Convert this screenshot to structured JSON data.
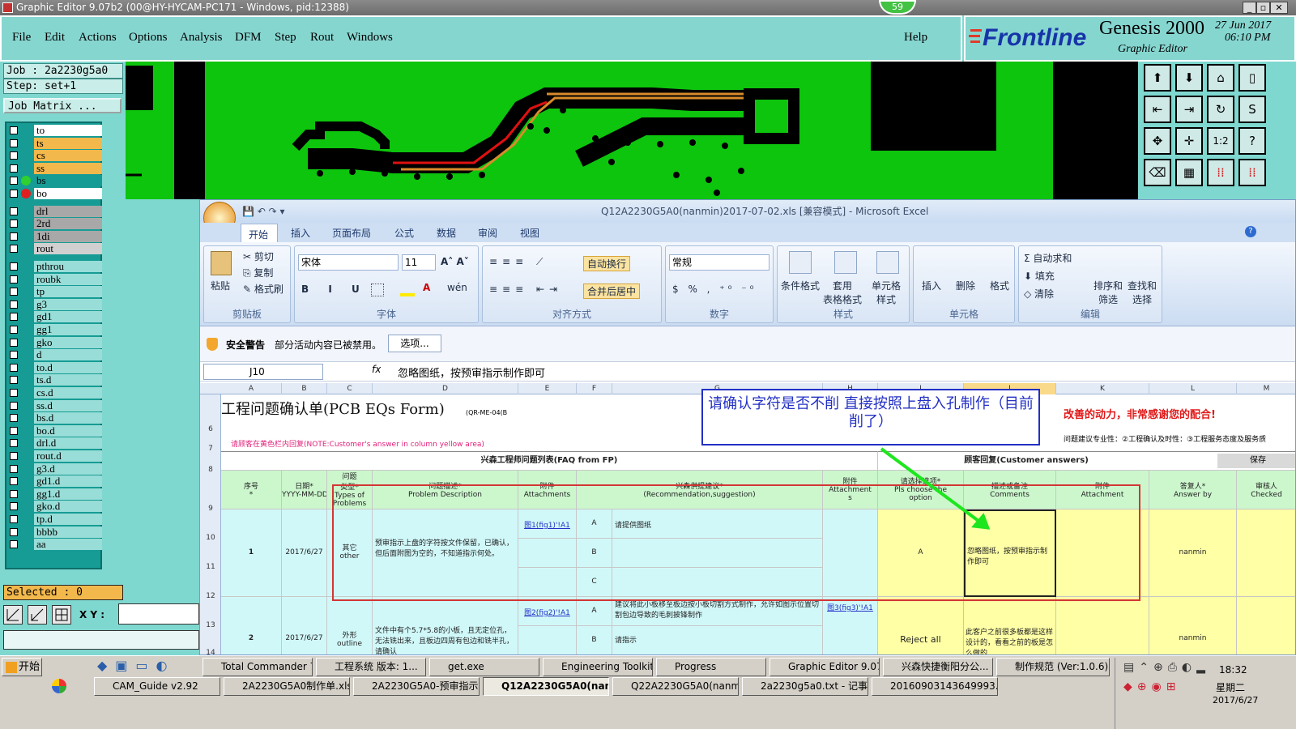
{
  "window": {
    "title": "Graphic Editor 9.07b2 (00@HY-HYCAM-PC171 - Windows, pid:12388)",
    "badge": "59"
  },
  "menu": [
    "File",
    "Edit",
    "Actions",
    "Options",
    "Analysis",
    "DFM",
    "Step",
    "Rout",
    "Windows"
  ],
  "help": "Help",
  "brand": {
    "logo": "Frontline",
    "product": "Genesis 2000",
    "subtitle": "Graphic Editor",
    "date": "27 Jun 2017",
    "time": "06:10 PM"
  },
  "job": {
    "job": "Job : 2a2230g5a0",
    "step": "Step: set+1",
    "matrix": "Job Matrix ..."
  },
  "layers": [
    {
      "name": "to",
      "color": "#ffffff",
      "dot": ""
    },
    {
      "name": "ts",
      "color": "#f3b84c",
      "dot": ""
    },
    {
      "name": "cs",
      "color": "#f3b84c",
      "dot": ""
    },
    {
      "name": "ss",
      "color": "#f3b84c",
      "dot": ""
    },
    {
      "name": "bs",
      "color": "#169c95",
      "dot": "#2fd02f"
    },
    {
      "name": "bo",
      "color": "#ffffff",
      "dot": "#e02020"
    },
    {
      "name": "drl",
      "color": "#a8a8a8",
      "dot": ""
    },
    {
      "name": "2rd",
      "color": "#a8a8a8",
      "dot": ""
    },
    {
      "name": "1di",
      "color": "#a8a8a8",
      "dot": ""
    },
    {
      "name": "rout",
      "color": "#d0d0d0",
      "dot": ""
    },
    {
      "name": "pthrou",
      "color": "#98ddd7",
      "dot": ""
    },
    {
      "name": "roubk",
      "color": "#98ddd7",
      "dot": ""
    },
    {
      "name": "tp",
      "color": "#98ddd7",
      "dot": ""
    },
    {
      "name": "g3",
      "color": "#98ddd7",
      "dot": ""
    },
    {
      "name": "gd1",
      "color": "#98ddd7",
      "dot": ""
    },
    {
      "name": "gg1",
      "color": "#98ddd7",
      "dot": ""
    },
    {
      "name": "gko",
      "color": "#98ddd7",
      "dot": ""
    },
    {
      "name": "d",
      "color": "#98ddd7",
      "dot": ""
    },
    {
      "name": "to.d",
      "color": "#98ddd7",
      "dot": ""
    },
    {
      "name": "ts.d",
      "color": "#98ddd7",
      "dot": ""
    },
    {
      "name": "cs.d",
      "color": "#98ddd7",
      "dot": ""
    },
    {
      "name": "ss.d",
      "color": "#98ddd7",
      "dot": ""
    },
    {
      "name": "bs.d",
      "color": "#98ddd7",
      "dot": ""
    },
    {
      "name": "bo.d",
      "color": "#98ddd7",
      "dot": ""
    },
    {
      "name": "drl.d",
      "color": "#98ddd7",
      "dot": ""
    },
    {
      "name": "rout.d",
      "color": "#98ddd7",
      "dot": ""
    },
    {
      "name": "g3.d",
      "color": "#98ddd7",
      "dot": ""
    },
    {
      "name": "gd1.d",
      "color": "#98ddd7",
      "dot": ""
    },
    {
      "name": "gg1.d",
      "color": "#98ddd7",
      "dot": ""
    },
    {
      "name": "gko.d",
      "color": "#98ddd7",
      "dot": ""
    },
    {
      "name": "tp.d",
      "color": "#98ddd7",
      "dot": ""
    },
    {
      "name": "bbbb",
      "color": "#98ddd7",
      "dot": ""
    },
    {
      "name": "aa",
      "color": "#98ddd7",
      "dot": ""
    }
  ],
  "selected": "Selected : 0",
  "xy_label": "X Y :",
  "excel": {
    "title": "Q12A2230G5A0(nanmin)2017-07-02.xls  [兼容模式] - Microsoft Excel",
    "tabs": [
      "开始",
      "插入",
      "页面布局",
      "公式",
      "数据",
      "审阅",
      "视图"
    ],
    "clipboard": {
      "paste": "粘贴",
      "cut": "剪切",
      "copy": "复制",
      "painter": "格式刷",
      "group": "剪贴板"
    },
    "font": {
      "name": "宋体",
      "size": "11",
      "group": "字体"
    },
    "align": {
      "wrap": "自动换行",
      "merge": "合并后居中",
      "group": "对齐方式"
    },
    "number": {
      "format": "常规",
      "group": "数字"
    },
    "styles": {
      "cond": "条件格式",
      "table": "套用\n表格格式",
      "cell": "单元格\n样式",
      "group": "样式"
    },
    "cells": {
      "insert": "插入",
      "delete": "删除",
      "format": "格式",
      "group": "单元格"
    },
    "edit": {
      "autosum": "自动求和",
      "fill": "填充",
      "clear": "清除",
      "sort": "排序和\n筛选",
      "find": "查找和\n选择",
      "group": "编辑"
    },
    "security": {
      "label": "安全警告",
      "msg": "部分活动内容已被禁用。",
      "btn": "选项..."
    },
    "namebox": "J10",
    "formula": "忽略图纸，按预审指示制作即可",
    "cols": [
      "A",
      "B",
      "C",
      "D",
      "E",
      "F",
      "G",
      "H",
      "I",
      "J",
      "K",
      "L",
      "M"
    ],
    "rows": [
      "6",
      "7",
      "8",
      "9",
      "10",
      "11",
      "12",
      "13",
      "14"
    ],
    "form_title": "工程问题确认单(PCB EQs Form)",
    "form_code": "(QR-ME-04(B",
    "note": "请顾客在黄色栏内回复(NOTE:Customer's answer in column yellow area)",
    "right_text": "改善的动力，非常感谢您的配合!",
    "right_note": "问题建议专业性：②工程确认及时性：③工程服务态度及服务质",
    "section_left": "兴森工程师问题列表(FAQ from FP)",
    "section_right": "顾客回复(Customer answers)",
    "save_btn": "保存",
    "headers": [
      "序号\n*",
      "日期*\nYYYY-MM-DD",
      "问题\n类型*\nTypes of\nProblems",
      "问题描述*\nProblem Description",
      "附件\nAttachments",
      "兴森供提建议*\n(Recommendation,suggestion)",
      "附件\nAttachment\ns",
      "请选择选项*\nPls choose the\noption",
      "描述或备注\nComments",
      "附件\nAttachment",
      "答复人*\nAnswer by",
      "审核人\nChecked"
    ],
    "row1": {
      "no": "1",
      "date": "2017/6/27",
      "type": "其它\nother",
      "desc": "预审指示上盘的字符按文件保留，已确认，但后面附图为空的，不知道指示何处。",
      "attach": "图1(fig1)'!A1",
      "optA": "A",
      "optB": "B",
      "optC": "C",
      "sugA": "请提供图纸",
      "choice": "A",
      "comment": "忽略图纸，按预审指示制作即可",
      "answer": "nanmin"
    },
    "row2": {
      "no": "2",
      "date": "2017/6/27",
      "type": "外形\noutline",
      "desc": "文件中有个5.7*5.8的小板，且无定位孔，无法铣出来，且板边四周有包边和铣半孔，请确认",
      "attach": "图2(fig2)'!A1",
      "optA": "A",
      "optB": "B",
      "sugA": "建议将此小板移至板边按小板切割方式制作，允许如图示位置切割包边导致的毛刺披锋制作",
      "sugB": "请指示",
      "attach2": "图3(fig3)'!A1",
      "choice": "Reject all",
      "comment": "此客户之前很多板都是这样设计的，看看之前的板是怎么做的",
      "answer": "nanmin"
    },
    "callout": "请确认字符是否不削   直接按照上盘入孔制作（目前削了）"
  },
  "taskbar": {
    "start": "开始",
    "row1": [
      "Total Commander 7....",
      "工程系统  版本: 1...",
      "get.exe",
      "Engineering Toolkit 9...",
      "Progress",
      "Graphic Editor 9.07b...",
      "兴森快捷衡阳分公...",
      "制作规范 (Ver:1.0.6)"
    ],
    "row2": [
      "CAM_Guide v2.92",
      "2A2230G5A0制作单.xls ...",
      "2A2230G5A0-预审指示...",
      "Q12A2230G5A0(nan...",
      "Q22A2230G5A0(nanmin)...",
      "2a2230g5a0.txt - 记事本",
      "20160903143649993.rtf..."
    ],
    "clock": "18:32",
    "weekday": "星期二",
    "date": "2017/6/27"
  }
}
